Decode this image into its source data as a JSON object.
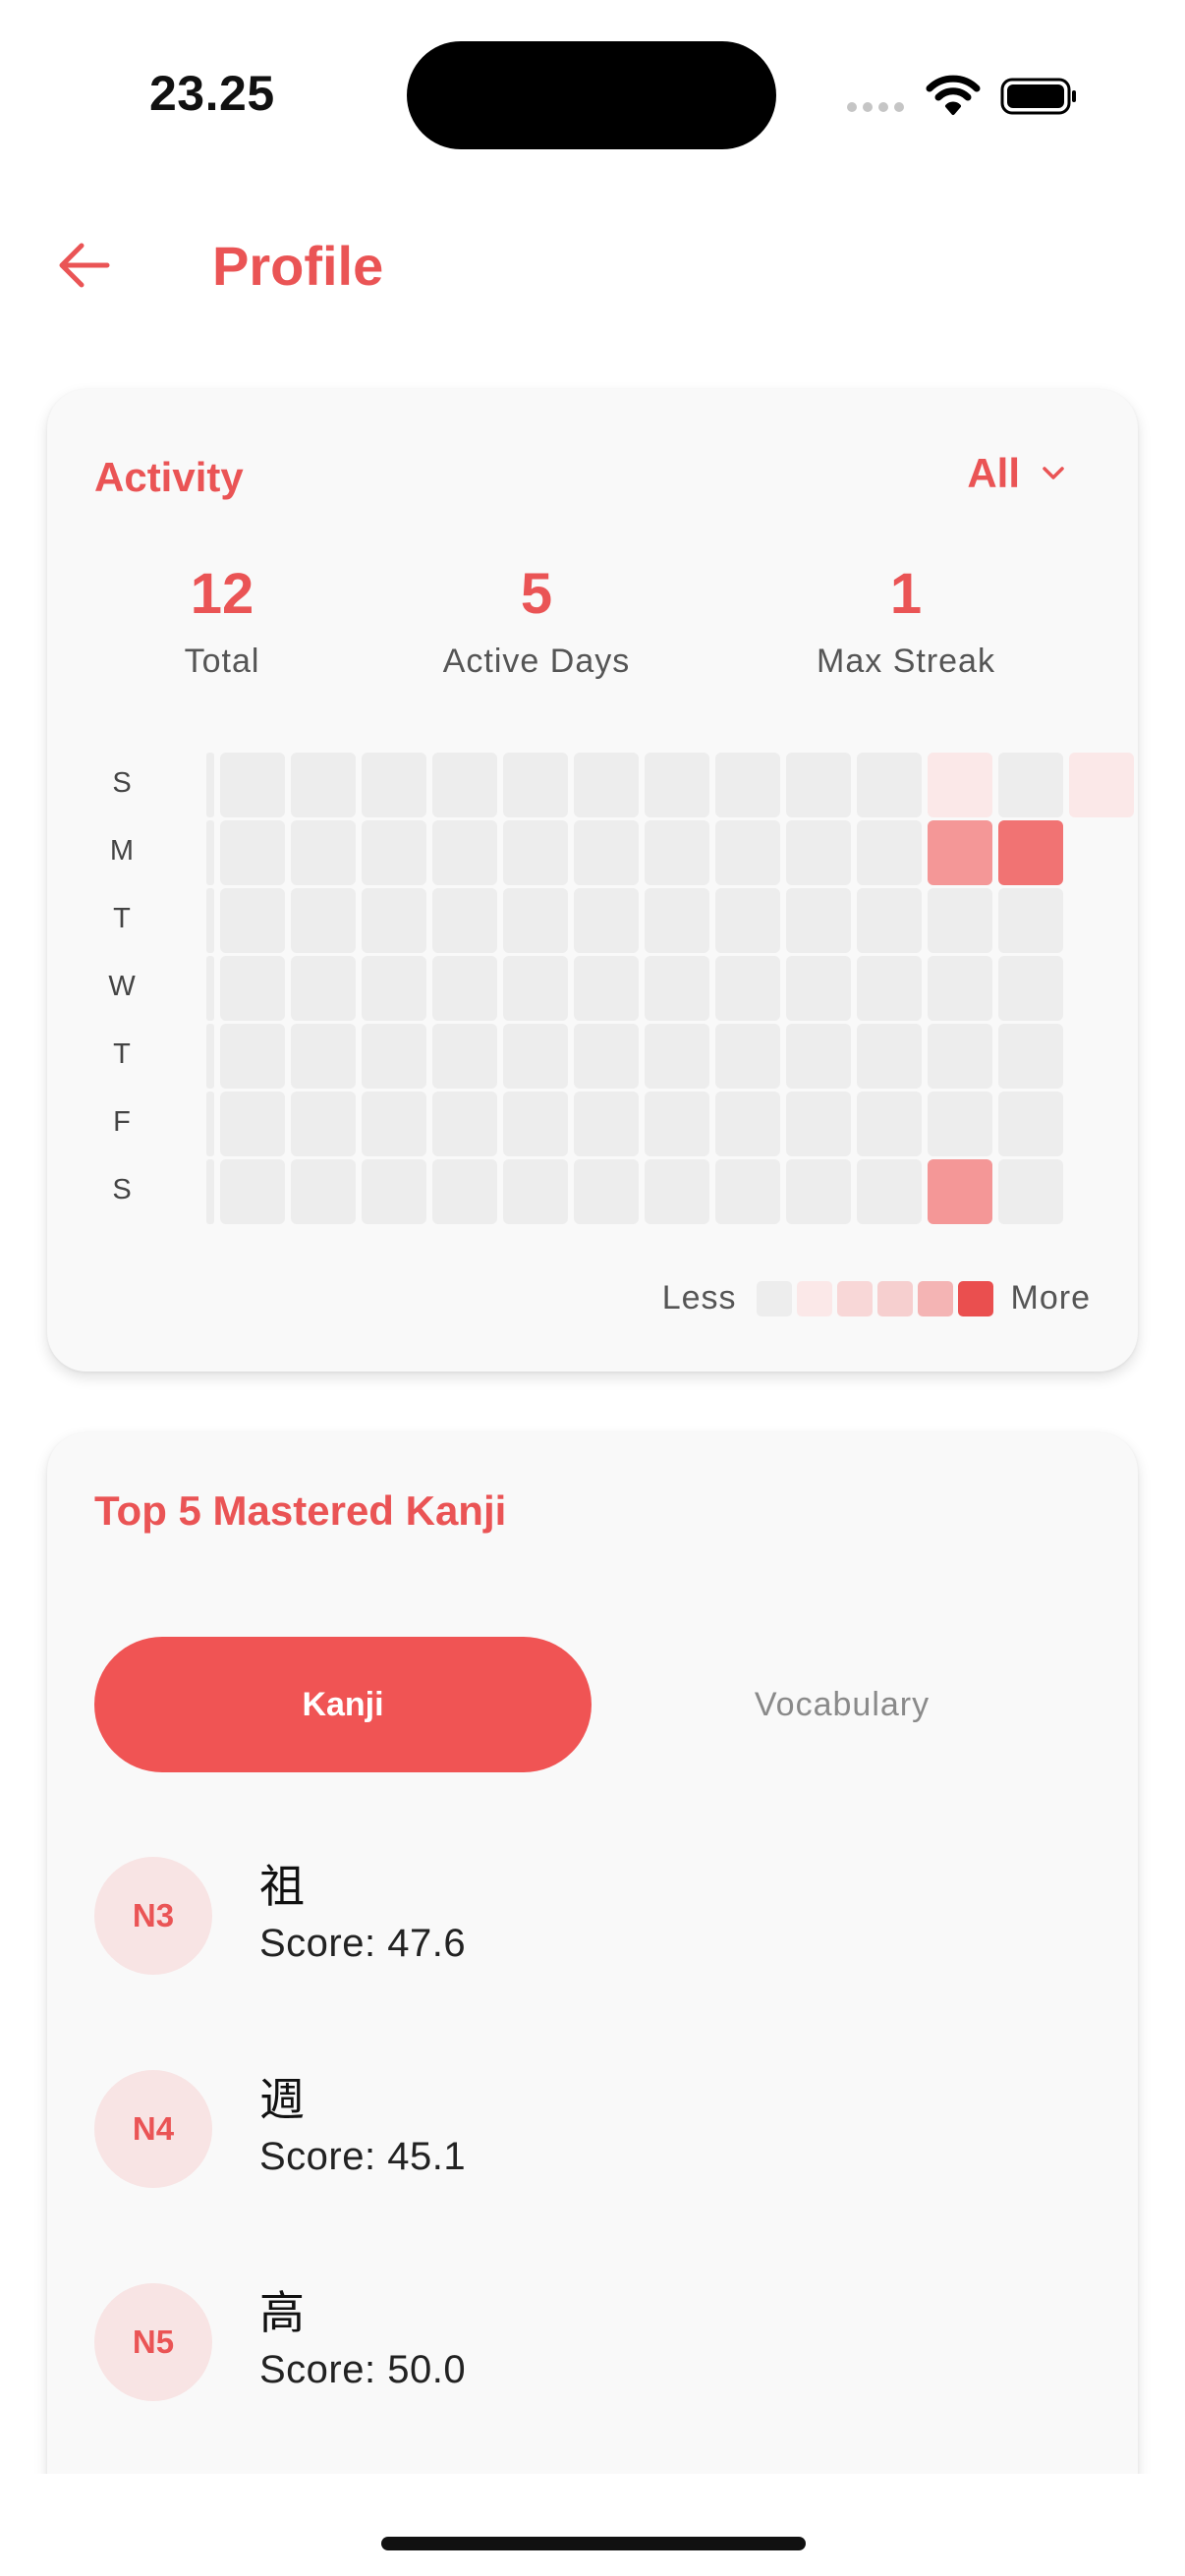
{
  "status_bar": {
    "time": "23.25"
  },
  "header": {
    "title": "Profile"
  },
  "colors": {
    "accent": "#ea5455",
    "accent_button": "#f05454",
    "cell_empty": "#ededed"
  },
  "activity": {
    "title": "Activity",
    "filter": {
      "selected": "All"
    },
    "stats": [
      {
        "value": "12",
        "label": "Total"
      },
      {
        "value": "5",
        "label": "Active Days"
      },
      {
        "value": "1",
        "label": "Max Streak"
      }
    ],
    "day_labels": [
      "S",
      "M",
      "T",
      "W",
      "T",
      "F",
      "S"
    ],
    "heatmap": {
      "levels": [
        [
          0,
          0,
          0,
          0,
          0,
          0,
          0,
          0,
          0,
          0,
          1,
          0,
          1
        ],
        [
          0,
          0,
          0,
          0,
          0,
          0,
          0,
          0,
          0,
          0,
          3,
          4
        ],
        [
          0,
          0,
          0,
          0,
          0,
          0,
          0,
          0,
          0,
          0,
          0,
          0
        ],
        [
          0,
          0,
          0,
          0,
          0,
          0,
          0,
          0,
          0,
          0,
          0,
          0
        ],
        [
          0,
          0,
          0,
          0,
          0,
          0,
          0,
          0,
          0,
          0,
          0,
          0
        ],
        [
          0,
          0,
          0,
          0,
          0,
          0,
          0,
          0,
          0,
          0,
          0,
          0
        ],
        [
          0,
          0,
          0,
          0,
          0,
          0,
          0,
          0,
          0,
          0,
          3,
          0
        ]
      ],
      "level_colors": [
        "#ededed",
        "#fbe8e8",
        "#f8d7d7",
        "#f49797",
        "#f17373",
        "#ea4f4f"
      ]
    },
    "legend": {
      "less": "Less",
      "more": "More",
      "colors": [
        "#ededed",
        "#fbe8e8",
        "#f8d7d7",
        "#f6cfcf",
        "#f4b4b4",
        "#ea4f4f"
      ]
    }
  },
  "mastered": {
    "title": "Top 5 Mastered Kanji",
    "tabs": [
      {
        "label": "Kanji",
        "active": true
      },
      {
        "label": "Vocabulary",
        "active": false
      }
    ],
    "items": [
      {
        "level": "N3",
        "kanji": "祖",
        "score": "Score: 47.6"
      },
      {
        "level": "N4",
        "kanji": "週",
        "score": "Score: 45.1"
      },
      {
        "level": "N5",
        "kanji": "高",
        "score": "Score: 50.0"
      }
    ]
  }
}
